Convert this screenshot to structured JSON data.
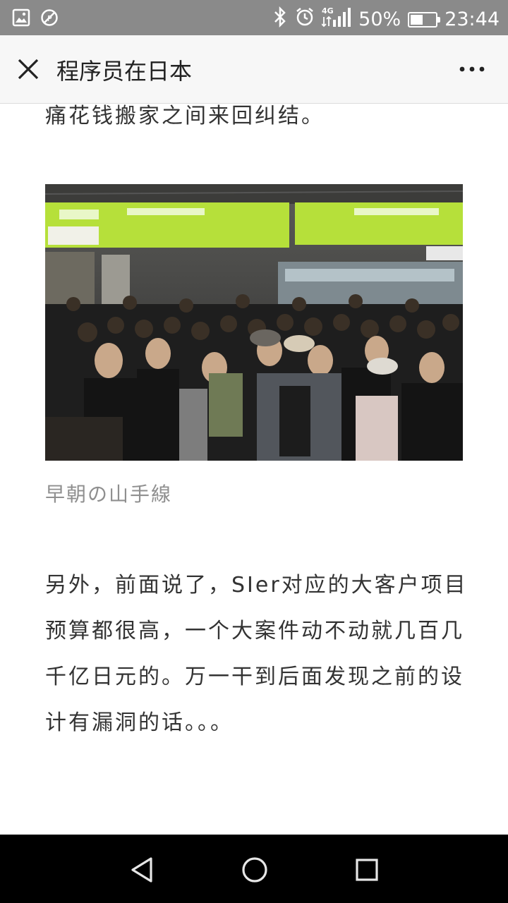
{
  "status_bar": {
    "icons_left": [
      "image-icon",
      "blocked-icon"
    ],
    "icons_right": [
      "bluetooth-icon",
      "alarm-icon",
      "signal-4g-icon",
      "battery-icon"
    ],
    "battery_percent": "50%",
    "battery_level": 0.5,
    "time": "23:44"
  },
  "title_bar": {
    "title": "程序员在日本",
    "close_icon": "close-icon",
    "more_icon": "more-icon"
  },
  "article": {
    "top_text": "痛花钱搬家之间来回纠结。",
    "image_caption": "早朝の山手線",
    "paragraph": "另外，前面说了，SIer对应的大客户项目预算都很高，一个大案件动不动就几百几千亿日元的。万一干到后面发现之前的设计有漏洞的话。。。"
  },
  "nav_bar": {
    "icons": [
      "back-icon",
      "home-icon",
      "recents-icon"
    ]
  },
  "colors": {
    "status_bar_bg": "#8a8a8a",
    "title_bar_bg": "#f7f7f7",
    "text": "#333333",
    "caption": "#8f8f8f",
    "nav_bar_bg": "#000000",
    "sign_green": "#b6e03a"
  }
}
